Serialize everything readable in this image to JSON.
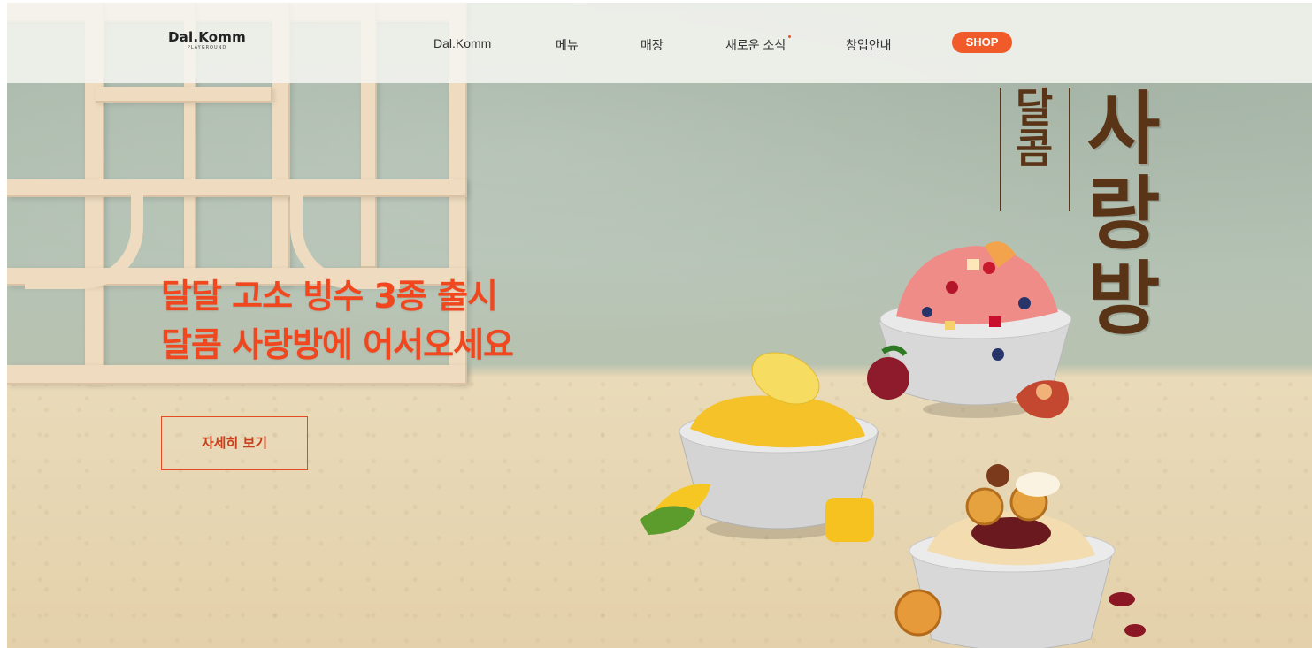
{
  "nav": {
    "logo": "Dal.Komm",
    "logo_sub": "PLAYGROUND",
    "items": [
      "Dal.Komm",
      "메뉴",
      "매장",
      "새로운 소식",
      "창업안내"
    ],
    "shop": "SHOP",
    "accent_color": "#f15a29"
  },
  "hero": {
    "headline_line1": "달달 고소 빙수 3종 출시",
    "headline_line2": "달콤 사랑방에 어서오세요",
    "cta": "자세히 보기",
    "vertical_small": [
      "달",
      "콤"
    ],
    "vertical_big": [
      "사",
      "랑",
      "방"
    ],
    "headline_color": "#f0471f",
    "calligraphy_color": "#5a3416"
  }
}
